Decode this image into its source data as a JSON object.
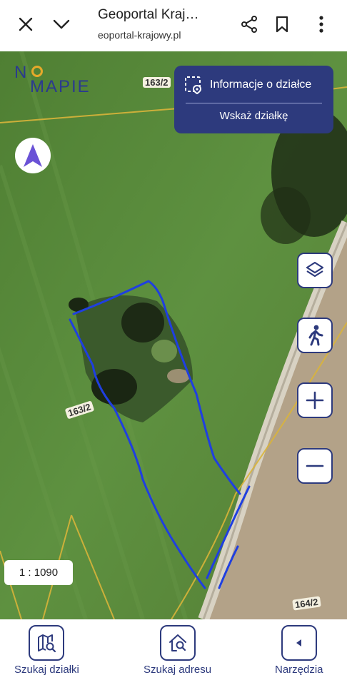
{
  "browser": {
    "title": "Geoportal Kraj…",
    "url": "eoportal-krajowy.pl",
    "icons": [
      "close-icon",
      "chevron-down-icon",
      "share-icon",
      "bookmark-icon",
      "more-vert-icon"
    ]
  },
  "map": {
    "logo_line1": "N",
    "logo_line2": "MAPIE",
    "info_panel": {
      "primary_label": "Informacje o działce",
      "secondary_label": "Wskaż działkę"
    },
    "parcel_labels": [
      "163/2",
      "163/2",
      "164/2"
    ],
    "scale": "1 : 1090",
    "buttons": [
      "layers-icon",
      "pedestrian-icon",
      "zoom-in-icon",
      "zoom-out-icon"
    ],
    "colors": {
      "accent": "#2d3a7d",
      "drawing": "#1f3fe0",
      "boundary": "#d9b43a"
    }
  },
  "bottom_nav": {
    "items": [
      {
        "label": "Szukaj działki",
        "icon": "map-search-icon"
      },
      {
        "label": "Szukaj adresu",
        "icon": "home-search-icon"
      },
      {
        "label": "Narzędzia",
        "icon": "caret-left-icon"
      }
    ]
  }
}
